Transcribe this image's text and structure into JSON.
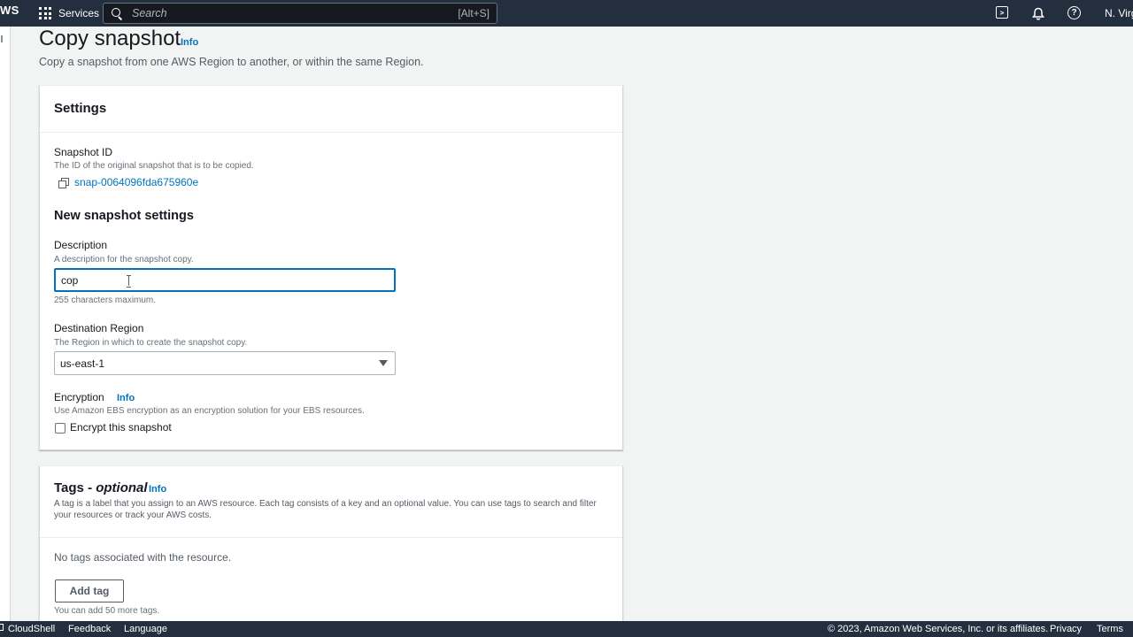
{
  "topnav": {
    "logo": "WS",
    "services_label": "Services",
    "search_placeholder": "Search",
    "search_shortcut": "[Alt+S]",
    "region": "N. Virg"
  },
  "page": {
    "title": "Copy snapshot",
    "title_info": "Info",
    "description": "Copy a snapshot from one AWS Region to another, or within the same Region."
  },
  "settings": {
    "heading": "Settings",
    "snapshot_id_label": "Snapshot ID",
    "snapshot_id_help": "The ID of the original snapshot that is to be copied.",
    "snapshot_id_value": "snap-0064096fda675960e",
    "new_settings_heading": "New snapshot settings",
    "description_label": "Description",
    "description_help": "A description for the snapshot copy.",
    "description_value": "cop",
    "description_constraint": "255 characters maximum.",
    "region_label": "Destination Region",
    "region_help": "The Region in which to create the snapshot copy.",
    "region_value": "us-east-1",
    "encryption_label": "Encryption",
    "encryption_info": "Info",
    "encryption_help": "Use Amazon EBS encryption as an encryption solution for your EBS resources.",
    "encrypt_checkbox_label": "Encrypt this snapshot",
    "encrypt_checked": false
  },
  "tags": {
    "heading_prefix": "Tags - ",
    "heading_optional": "optional",
    "info": "Info",
    "description": "A tag is a label that you assign to an AWS resource. Each tag consists of a key and an optional value. You can use tags to search and filter your resources or track your AWS costs.",
    "empty_message": "No tags associated with the resource.",
    "add_button": "Add tag",
    "limit_help": "You can add 50 more tags."
  },
  "footer": {
    "cloudshell": "CloudShell",
    "feedback": "Feedback",
    "language": "Language",
    "copyright": "© 2023, Amazon Web Services, Inc. or its affiliates.",
    "privacy": "Privacy",
    "terms": "Terms"
  }
}
